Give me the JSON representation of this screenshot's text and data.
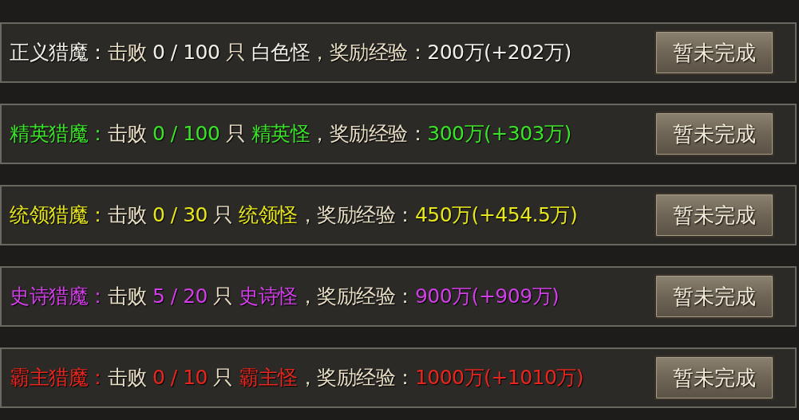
{
  "quests": [
    {
      "color": "#f2efe6",
      "segments": [
        {
          "text": "正义猎魔：",
          "colored": true
        },
        {
          "text": "击败 ",
          "colored": false
        },
        {
          "text": "0 / 100",
          "colored": true
        },
        {
          "text": " 只 ",
          "colored": false
        },
        {
          "text": "白色怪",
          "colored": true
        },
        {
          "text": "，奖励经验：",
          "colored": false
        },
        {
          "text": "200万(+202万)",
          "colored": true
        }
      ],
      "button": "暂未完成"
    },
    {
      "color": "#3be22a",
      "segments": [
        {
          "text": "精英猎魔：",
          "colored": true
        },
        {
          "text": "击败 ",
          "colored": false
        },
        {
          "text": "0 / 100",
          "colored": true
        },
        {
          "text": " 只 ",
          "colored": false
        },
        {
          "text": "精英怪",
          "colored": true
        },
        {
          "text": "，奖励经验：",
          "colored": false
        },
        {
          "text": "300万(+303万)",
          "colored": true
        }
      ],
      "button": "暂未完成"
    },
    {
      "color": "#e6e61e",
      "segments": [
        {
          "text": "统领猎魔：",
          "colored": true
        },
        {
          "text": "击败 ",
          "colored": false
        },
        {
          "text": "0 / 30",
          "colored": true
        },
        {
          "text": " 只 ",
          "colored": false
        },
        {
          "text": "统领怪",
          "colored": true
        },
        {
          "text": "，奖励经验：",
          "colored": false
        },
        {
          "text": "450万(+454.5万)",
          "colored": true
        }
      ],
      "button": "暂未完成"
    },
    {
      "color": "#d23ee8",
      "segments": [
        {
          "text": "史诗猎魔：",
          "colored": true
        },
        {
          "text": "击败 ",
          "colored": false
        },
        {
          "text": "5 / 20",
          "colored": true
        },
        {
          "text": " 只 ",
          "colored": false
        },
        {
          "text": "史诗怪",
          "colored": true
        },
        {
          "text": "，奖励经验：",
          "colored": false
        },
        {
          "text": "900万(+909万)",
          "colored": true
        }
      ],
      "button": "暂未完成"
    },
    {
      "color": "#e8261e",
      "segments": [
        {
          "text": "霸主猎魔：",
          "colored": true
        },
        {
          "text": "击败 ",
          "colored": false
        },
        {
          "text": "0 / 10",
          "colored": true
        },
        {
          "text": " 只 ",
          "colored": false
        },
        {
          "text": "霸主怪",
          "colored": true
        },
        {
          "text": "，奖励经验：",
          "colored": false
        },
        {
          "text": "1000万(+1010万)",
          "colored": true
        }
      ],
      "button": "暂未完成"
    }
  ]
}
